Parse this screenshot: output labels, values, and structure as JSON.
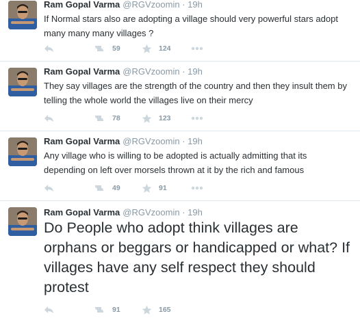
{
  "tweets": [
    {
      "name": "Ram Gopal Varma",
      "handle": "@RGVzoomin",
      "dot": "·",
      "time": "19h",
      "text": "If Normal stars also are adopting a village  should very powerful stars adopt many many many villages ?",
      "retweets": "59",
      "favorites": "124"
    },
    {
      "name": "Ram Gopal Varma",
      "handle": "@RGVzoomin",
      "dot": "·",
      "time": "19h",
      "text": "They say villages are the strength of the country and then they insult them by telling the whole world the villages live on their mercy",
      "retweets": "78",
      "favorites": "123"
    },
    {
      "name": "Ram Gopal Varma",
      "handle": "@RGVzoomin",
      "dot": "·",
      "time": "19h",
      "text": "Any village who is willing to be adopted is actually admitting that its depending on left over morsels thrown at it by the rich and famous",
      "retweets": "49",
      "favorites": "91"
    },
    {
      "name": "Ram Gopal Varma",
      "handle": "@RGVzoomin",
      "dot": "·",
      "time": "19h",
      "text": "Do People who adopt think villages are orphans or beggars or handicapped or what? If villages have any self respect they should protest",
      "retweets": "91",
      "favorites": "165"
    }
  ],
  "icons": {
    "reply": "reply-icon",
    "retweet": "retweet-icon",
    "favorite": "star-icon",
    "more": "more-icon"
  },
  "colors": {
    "text": "#292f33",
    "muted": "#8899a6",
    "divider": "#e1e8ed"
  }
}
